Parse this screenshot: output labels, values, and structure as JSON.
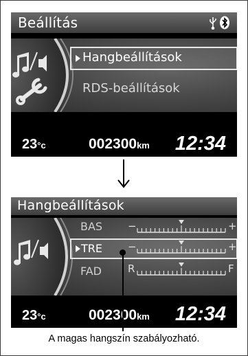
{
  "screen_top": {
    "title": "Beállítás",
    "menu_items": [
      {
        "label": "Hangbeállítások",
        "selected": true
      },
      {
        "label": "RDS-beállítások",
        "selected": false
      }
    ],
    "status_icons": [
      "usb-icon",
      "bluetooth-icon"
    ]
  },
  "screen_bottom": {
    "title": "Hangbeállítások",
    "rows": [
      {
        "label": "BAS",
        "left_mark": "−",
        "right_mark": "+",
        "level": 0.5,
        "selected": false
      },
      {
        "label": "TRE",
        "left_mark": "−",
        "right_mark": "+",
        "level": 0.5,
        "selected": true
      },
      {
        "label": "FAD",
        "left_mark": "R",
        "right_mark": "F",
        "level": 0.5,
        "selected": false
      }
    ]
  },
  "info_bar": {
    "temperature": "23",
    "temperature_unit": "°c",
    "odometer": "002300",
    "odometer_unit": "km",
    "clock": "12:34"
  },
  "caption": "A magas hangszín szabályozható.",
  "colors": {
    "title_bar": "#4e4e4e",
    "background": "#000000",
    "text": "#ffffff",
    "highlight_border": "#e6e6e6"
  }
}
